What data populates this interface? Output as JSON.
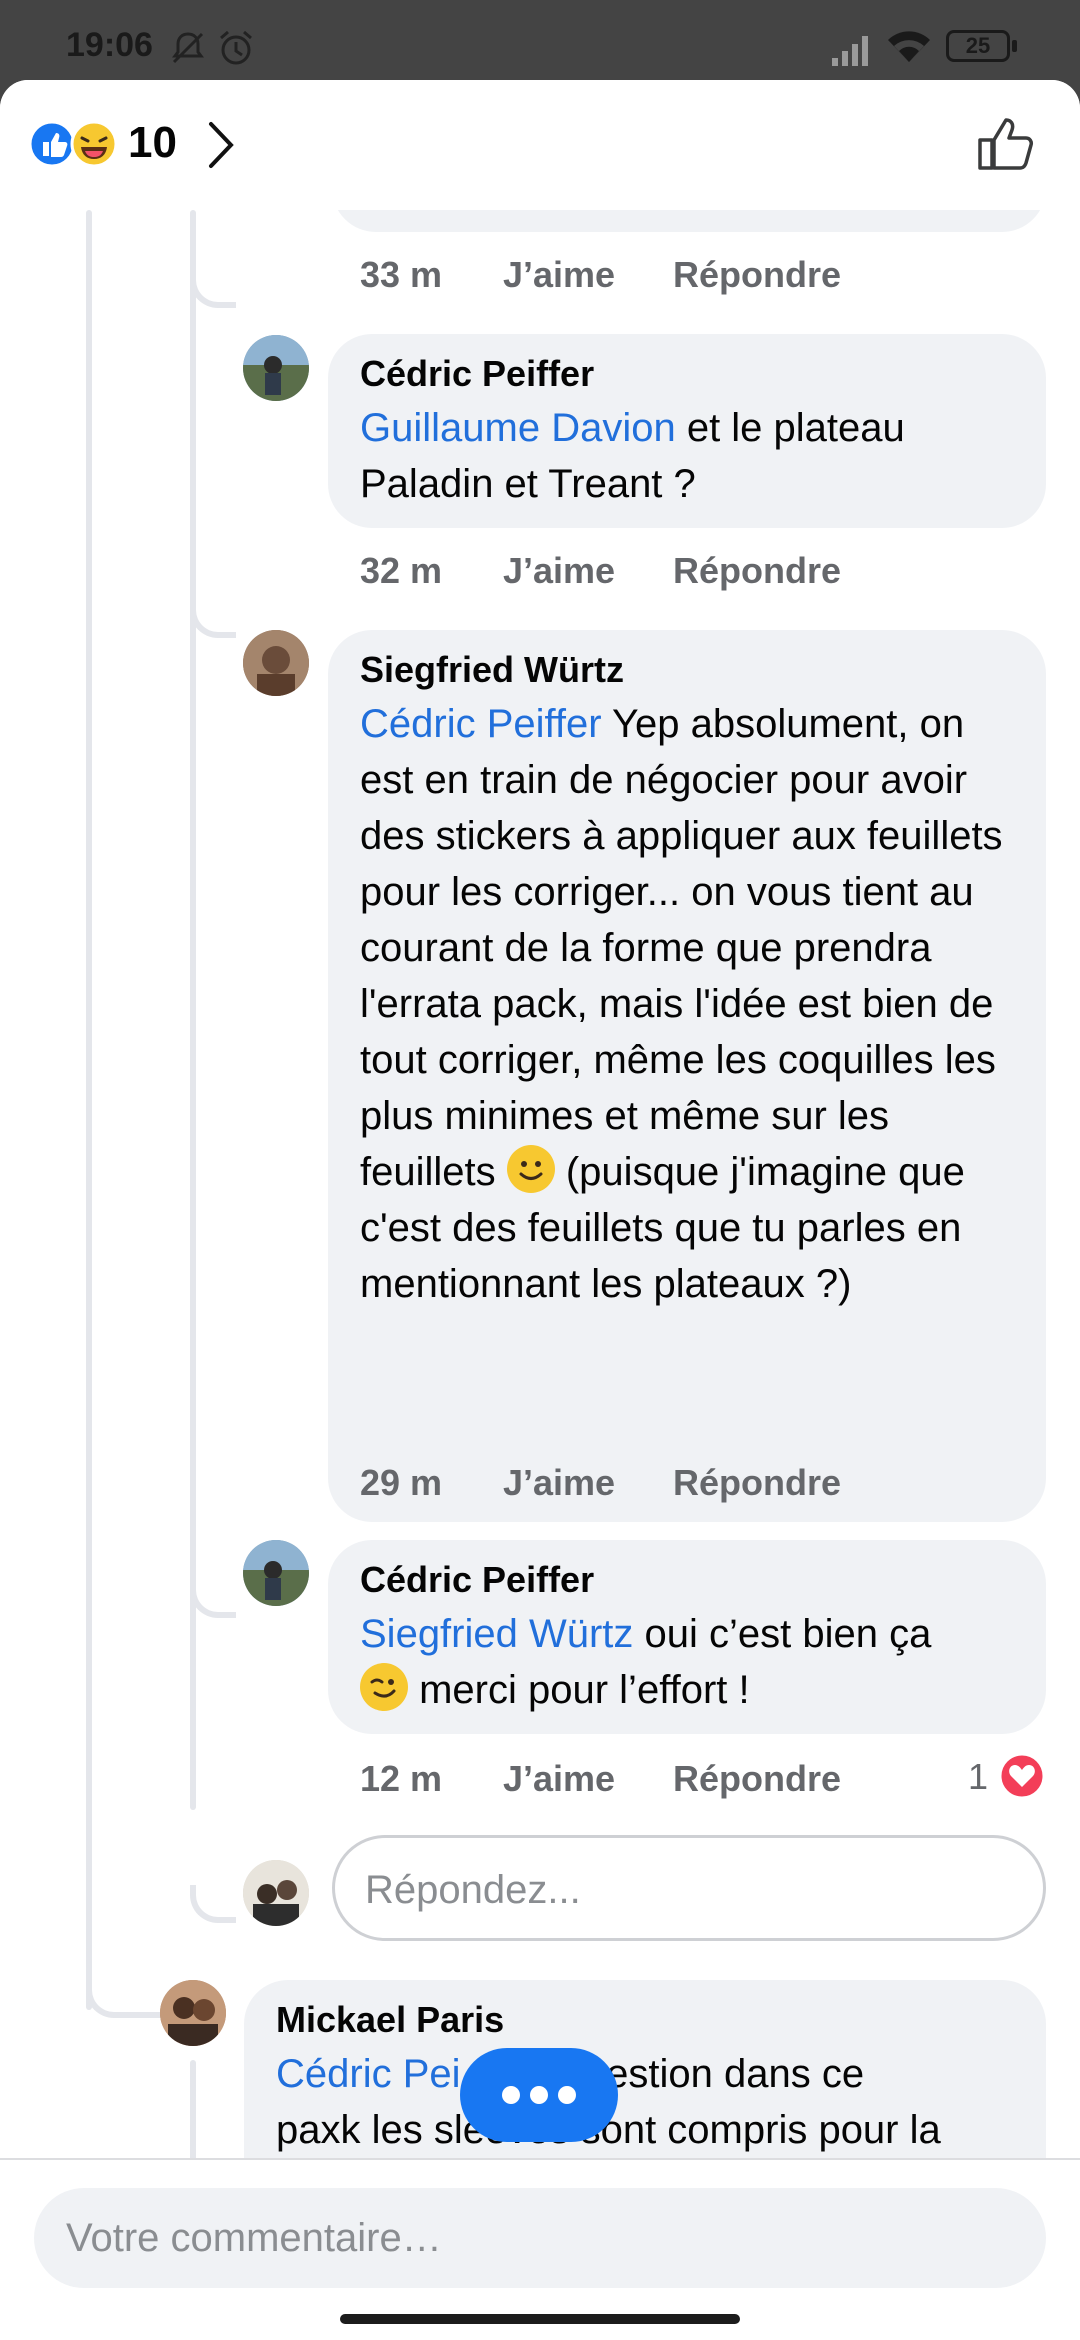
{
  "status_bar": {
    "time": "19:06",
    "battery": "25"
  },
  "header": {
    "reaction_count": "10"
  },
  "comments": [
    {
      "time": "33 m",
      "like": "J’aime",
      "reply": "Répondre"
    },
    {
      "author": "Cédric Peiffer",
      "mention": "Guillaume Davion",
      "text": " et le plateau Paladin et Treant ?",
      "time": "32 m",
      "like": "J’aime",
      "reply": "Répondre"
    },
    {
      "author": "Siegfried Würtz",
      "mention": "Cédric Peiffer",
      "text_part1": " Yep absolument, on est en train de négocier pour avoir des stickers à appliquer aux feuillets pour les corriger... on vous tient au courant de la forme que prendra l'errata pack, mais l'idée est bien de tout corriger, même les coquilles les plus minimes et même sur les feuillets ",
      "text_part2": " (puisque j'imagine que c'est des feuillets que tu parles en mentionnant les plateaux ?)",
      "time": "29 m",
      "like": "J’aime",
      "reply": "Répondre"
    },
    {
      "author": "Cédric Peiffer",
      "mention": "Siegfried Würtz",
      "text_part1": " oui c’est bien ça ",
      "text_part2": " merci pour l’effort !",
      "time": "12 m",
      "like": "J’aime",
      "reply": "Répondre",
      "reaction_count": "1"
    },
    {
      "author": "Mickael Paris",
      "mention": "Cédric Pei",
      "text_part1": "it question dans ce",
      "text_line2": "paxk les sleeves sont compris pour la"
    }
  ],
  "reply_input": {
    "placeholder": "Répondez..."
  },
  "comment_input": {
    "placeholder": "Votre commentaire…"
  },
  "colors": {
    "mention": "#216fdb",
    "bubble": "#f0f2f5",
    "accent": "#1877f2"
  }
}
